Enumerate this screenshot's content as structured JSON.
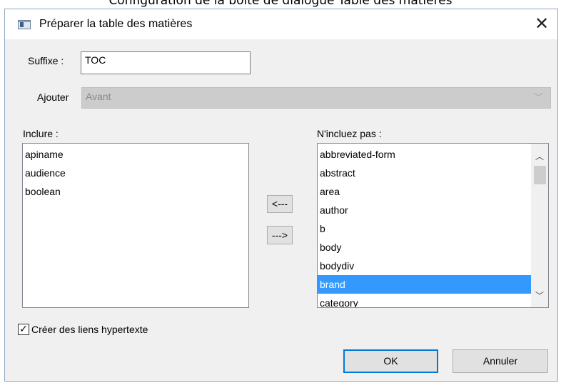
{
  "caption": "Configuration de la boîte de dialogue Table des matières",
  "dialog": {
    "title": "Préparer la table des matières",
    "close_glyph": "✕"
  },
  "suffix": {
    "label": "Suffixe :",
    "value": "TOC"
  },
  "position": {
    "label": "Ajouter",
    "value": "Avant",
    "chevron": "﹀"
  },
  "include": {
    "label": "Inclure :",
    "items": [
      "apiname",
      "audience",
      "boolean"
    ]
  },
  "exclude": {
    "label": "N'incluez pas :",
    "items": [
      "abbreviated-form",
      "abstract",
      "area",
      "author",
      "b",
      "body",
      "bodydiv",
      "brand",
      "category"
    ],
    "selected": "brand"
  },
  "move_buttons": {
    "left": "<---",
    "right": "--->"
  },
  "scroll": {
    "up": "︿",
    "down": "﹀"
  },
  "hyperlinks": {
    "label": "Créer des liens hypertexte",
    "checked": true,
    "check_glyph": "✓"
  },
  "buttons": {
    "ok": "OK",
    "cancel": "Annuler"
  }
}
